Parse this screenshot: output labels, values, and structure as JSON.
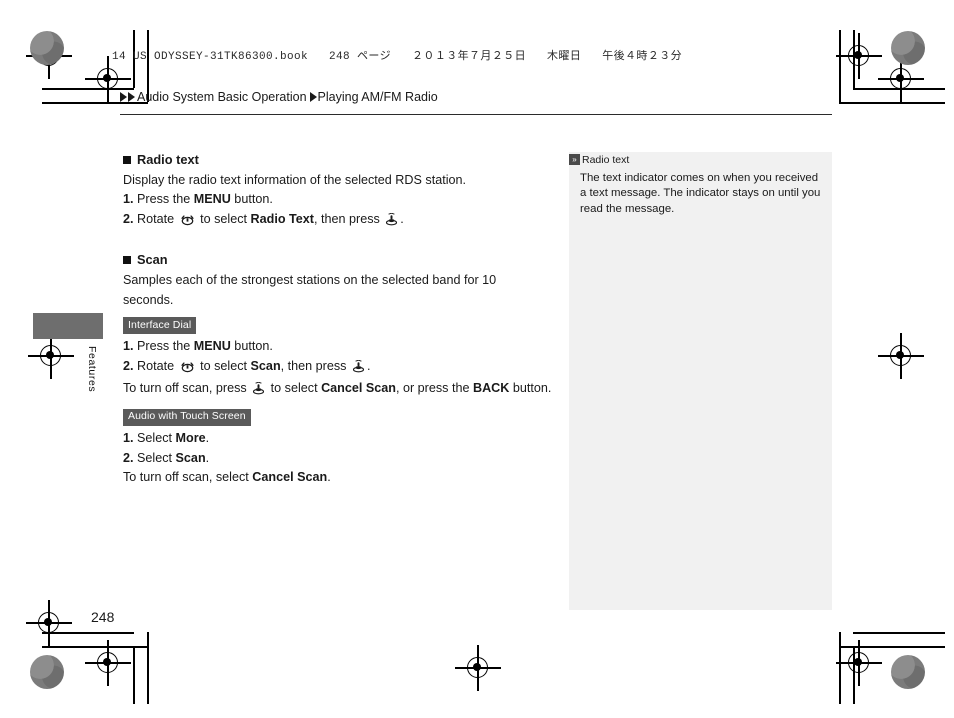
{
  "document": {
    "book_header": "14 US ODYSSEY-31TK86300.book   248 ページ   ２０１３年７月２５日   木曜日   午後４時２３分",
    "page_number": "248",
    "side_tab_label": "Features"
  },
  "breadcrumb": {
    "level1": "Audio System Basic Operation",
    "level2": "Playing AM/FM Radio"
  },
  "sections": [
    {
      "heading": "Radio text",
      "intro": "Display the radio text information of the selected RDS station.",
      "steps": [
        {
          "num": "1.",
          "before": "Press the ",
          "bold": "MENU",
          "after": " button."
        },
        {
          "num": "2.",
          "before": "Rotate ",
          "icon1": "dial-rotate-icon",
          "mid": " to select ",
          "bold": "Radio Text",
          "after2": ", then press ",
          "icon2": "dial-press-icon",
          "end": "."
        }
      ]
    },
    {
      "heading": "Scan",
      "intro": "Samples each of the strongest stations on the selected band for 10 seconds.",
      "tag_interface_dial": "Interface Dial",
      "dial_steps": [
        {
          "num": "1.",
          "before": "Press the ",
          "bold": "MENU",
          "after": " button."
        },
        {
          "num": "2.",
          "before": "Rotate ",
          "icon1": "dial-rotate-icon",
          "mid": " to select ",
          "bold": "Scan",
          "after2": ", then press ",
          "icon2": "dial-press-icon",
          "end": "."
        }
      ],
      "dial_note_a": "To turn off scan, press ",
      "dial_note_b": " to select ",
      "dial_note_bold1": "Cancel Scan",
      "dial_note_c": ", or press the ",
      "dial_note_bold2": "BACK",
      "dial_note_d": " button.",
      "tag_touch_screen": "Audio with Touch Screen",
      "touch_steps": [
        {
          "num": "1.",
          "before": "Select ",
          "bold": "More",
          "after": "."
        },
        {
          "num": "2.",
          "before": "Select ",
          "bold": "Scan",
          "after": "."
        }
      ],
      "touch_note_before": "To turn off scan, select ",
      "touch_note_bold": "Cancel Scan",
      "touch_note_after": "."
    }
  ],
  "note": {
    "badge": "»",
    "title": "Radio text",
    "body": "The text indicator comes on when you received a text message. The indicator stays on until you read the message."
  },
  "colors": {
    "tag_background": "#5a5a5a",
    "note_panel_background": "#f1f1f1",
    "side_tab": "#6e6e6e",
    "text": "#1a1a1a"
  }
}
